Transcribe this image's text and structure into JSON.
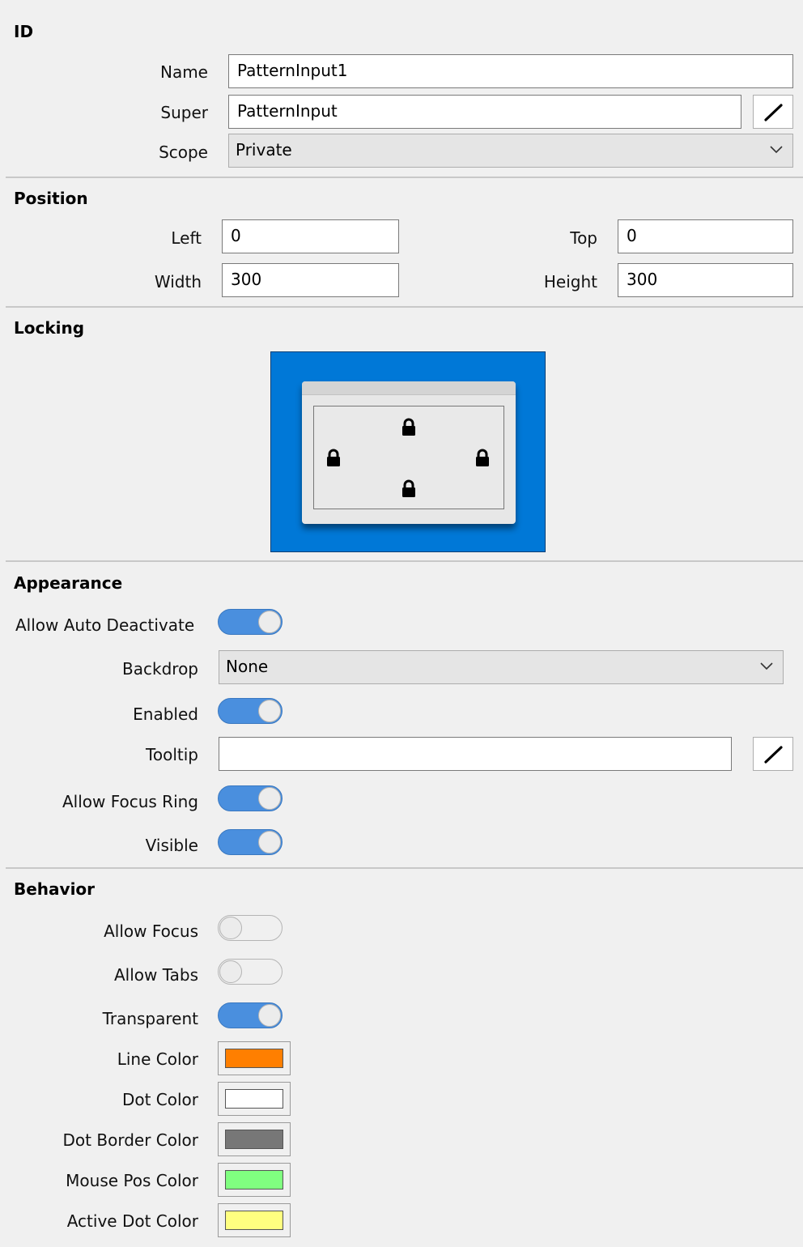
{
  "id_section": {
    "title": "ID",
    "name_label": "Name",
    "name_value": "PatternInput1",
    "super_label": "Super",
    "super_value": "PatternInput",
    "scope_label": "Scope",
    "scope_value": "Private"
  },
  "position_section": {
    "title": "Position",
    "left_label": "Left",
    "left_value": "0",
    "top_label": "Top",
    "top_value": "0",
    "width_label": "Width",
    "width_value": "300",
    "height_label": "Height",
    "height_value": "300"
  },
  "locking_section": {
    "title": "Locking",
    "locks": [
      "top",
      "left",
      "right",
      "bottom"
    ],
    "background_color": "#0078d7"
  },
  "appearance_section": {
    "title": "Appearance",
    "allow_auto_deactivate_label": "Allow Auto Deactivate",
    "allow_auto_deactivate": true,
    "backdrop_label": "Backdrop",
    "backdrop_value": "None",
    "enabled_label": "Enabled",
    "enabled": true,
    "tooltip_label": "Tooltip",
    "tooltip_value": "",
    "allow_focus_ring_label": "Allow Focus Ring",
    "allow_focus_ring": true,
    "visible_label": "Visible",
    "visible": true
  },
  "behavior_section": {
    "title": "Behavior",
    "allow_focus_label": "Allow Focus",
    "allow_focus": false,
    "allow_tabs_label": "Allow Tabs",
    "allow_tabs": false,
    "transparent_label": "Transparent",
    "transparent": true,
    "line_color_label": "Line Color",
    "line_color": "#ff7f00",
    "dot_color_label": "Dot Color",
    "dot_color": "#ffffff",
    "dot_border_color_label": "Dot Border Color",
    "dot_border_color": "#777777",
    "mouse_pos_color_label": "Mouse Pos Color",
    "mouse_pos_color": "#80ff80",
    "active_dot_color_label": "Active Dot Color",
    "active_dot_color": "#ffff80"
  },
  "colors": {
    "toggle_on": "#4a8fde",
    "panel_background": "#f0f0f0"
  }
}
